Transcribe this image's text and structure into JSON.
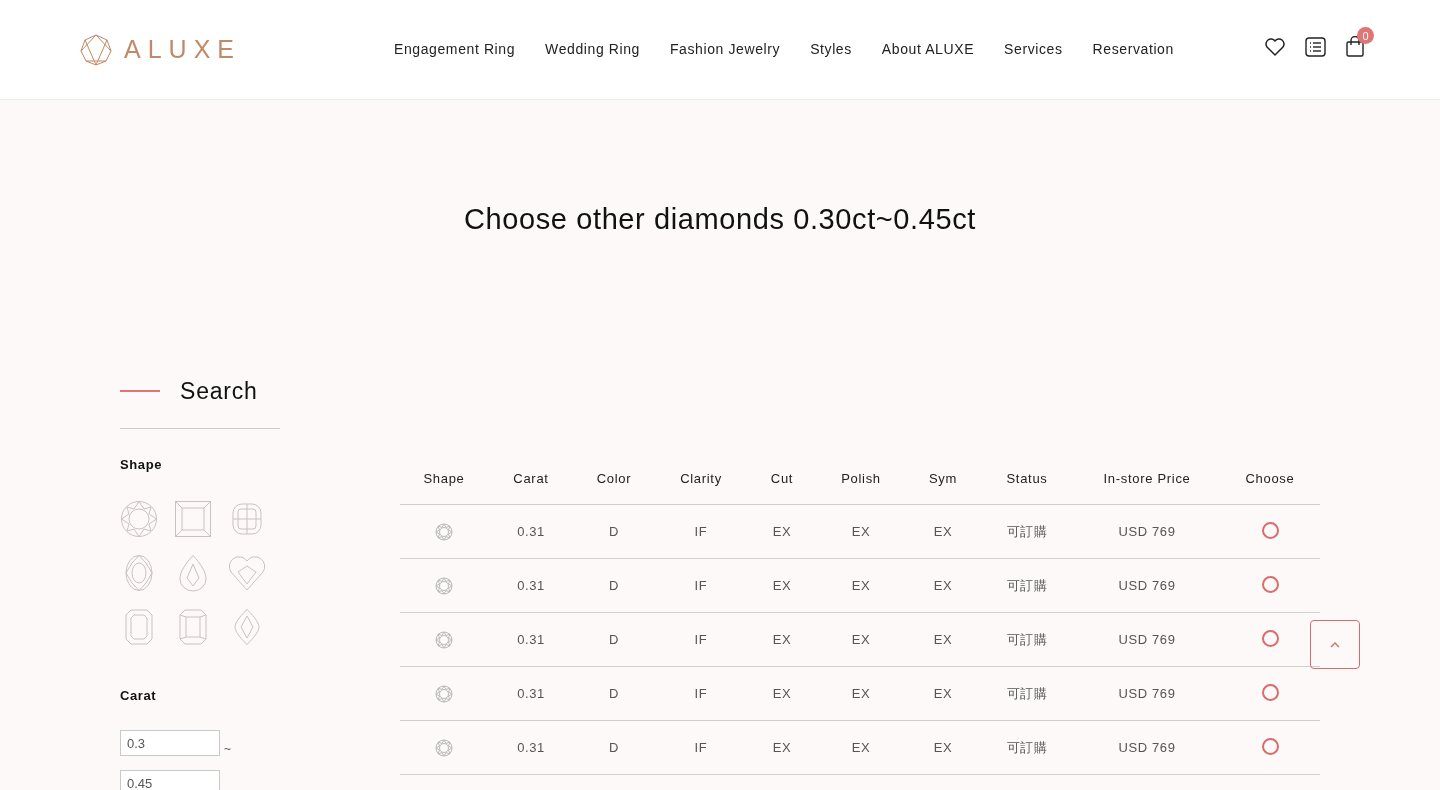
{
  "header": {
    "logo": "ALUXE",
    "nav": [
      "Engagement Ring",
      "Wedding Ring",
      "Fashion Jewelry",
      "Styles",
      "About ALUXE",
      "Services",
      "Reservation"
    ],
    "cart_count": "0"
  },
  "title": "Choose other diamonds 0.30ct~0.45ct",
  "search": {
    "heading": "Search",
    "shape_label": "Shape",
    "carat_label": "Carat",
    "carat_min": "0.3",
    "separator": "~",
    "carat_max": "0.45"
  },
  "table": {
    "columns": [
      "Shape",
      "Carat",
      "Color",
      "Clarity",
      "Cut",
      "Polish",
      "Sym",
      "Status",
      "In-store Price",
      "Choose"
    ],
    "rows": [
      {
        "carat": "0.31",
        "color_grade": "D",
        "clarity": "IF",
        "cut": "EX",
        "polish": "EX",
        "sym": "EX",
        "status": "可訂購",
        "price": "USD 769",
        "selected": false
      },
      {
        "carat": "0.31",
        "color_grade": "D",
        "clarity": "IF",
        "cut": "EX",
        "polish": "EX",
        "sym": "EX",
        "status": "可訂購",
        "price": "USD 769",
        "selected": false
      },
      {
        "carat": "0.31",
        "color_grade": "D",
        "clarity": "IF",
        "cut": "EX",
        "polish": "EX",
        "sym": "EX",
        "status": "可訂購",
        "price": "USD 769",
        "selected": false
      },
      {
        "carat": "0.31",
        "color_grade": "D",
        "clarity": "IF",
        "cut": "EX",
        "polish": "EX",
        "sym": "EX",
        "status": "可訂購",
        "price": "USD 769",
        "selected": false
      },
      {
        "carat": "0.31",
        "color_grade": "D",
        "clarity": "IF",
        "cut": "EX",
        "polish": "EX",
        "sym": "EX",
        "status": "可訂購",
        "price": "USD 769",
        "selected": false
      }
    ]
  }
}
